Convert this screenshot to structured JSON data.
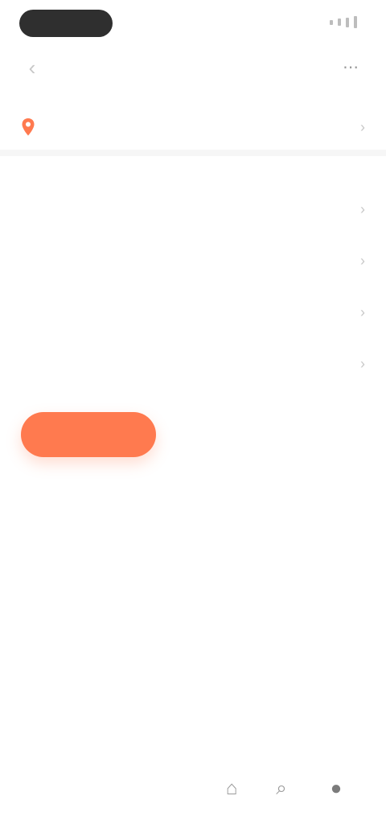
{
  "status_bar": {
    "time": "",
    "signal_icon": "signal-icon"
  },
  "header": {
    "back_icon": "chevron-left-icon",
    "title": "",
    "action_icon": "share-icon"
  },
  "location": {
    "pin_icon": "pin-icon",
    "text": "",
    "extra": "",
    "chevron_icon": "chevron-right-icon"
  },
  "list": [
    {
      "label": "",
      "chevron_icon": "chevron-right-icon"
    },
    {
      "label": "",
      "chevron_icon": "chevron-right-icon"
    },
    {
      "label": "",
      "chevron_icon": "chevron-right-icon"
    },
    {
      "label": "",
      "chevron_icon": "chevron-right-icon"
    }
  ],
  "primary_button": {
    "label": ""
  },
  "bottom_nav": [
    {
      "icon": "home-icon"
    },
    {
      "icon": "search-icon"
    },
    {
      "icon": "profile-icon"
    }
  ],
  "colors": {
    "accent": "#ff7a4f",
    "text": "#3a3a3a",
    "muted": "#9b9b9b",
    "divider": "#f6f6f6"
  }
}
